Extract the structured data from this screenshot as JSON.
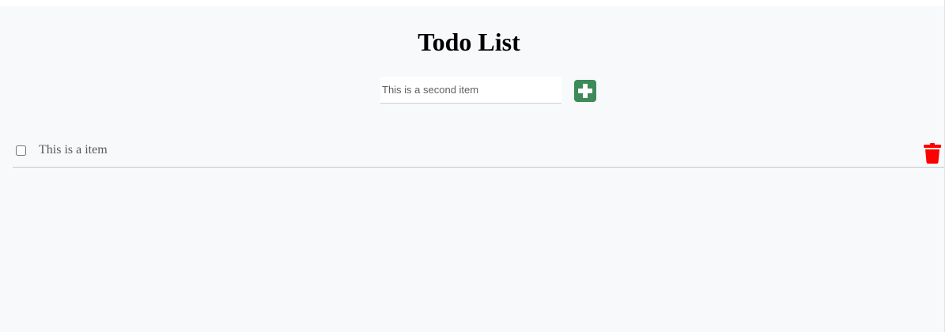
{
  "header": {
    "title": "Todo List"
  },
  "add_form": {
    "input_value": "This is a second item",
    "add_icon": "plus-square-icon",
    "add_color": "#3d8a5a"
  },
  "todos": [
    {
      "text": "This is a item",
      "completed": false,
      "delete_icon": "trash-icon",
      "delete_color": "#ff0000"
    }
  ]
}
